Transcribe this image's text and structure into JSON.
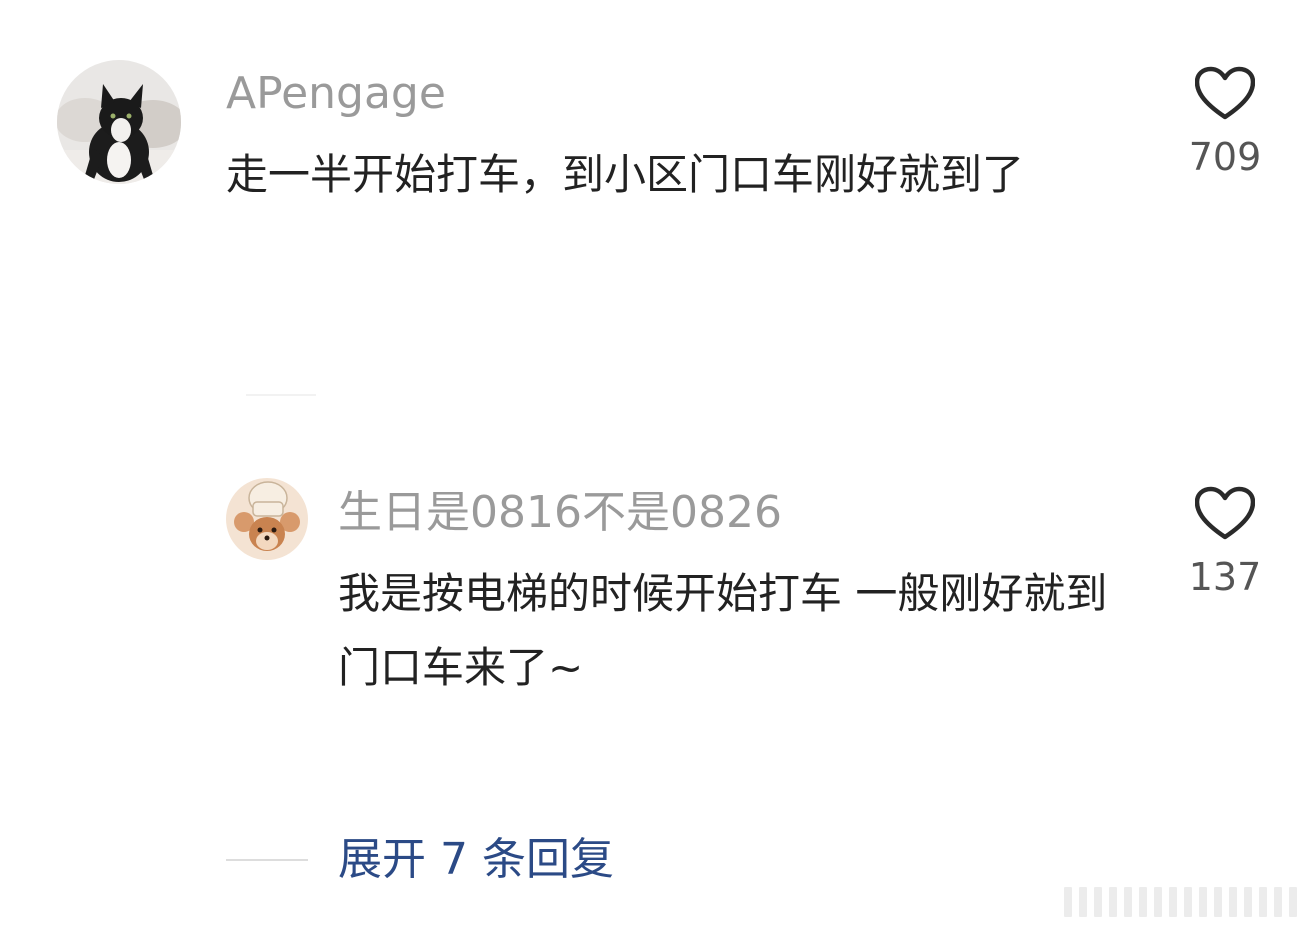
{
  "comments": [
    {
      "username": "APengage",
      "text": "走一半开始打车，到小区门口车刚好就到了",
      "likes": "709",
      "avatar": "cat-avatar"
    },
    {
      "username": "生日是0816不是0826",
      "text": "我是按电梯的时候开始打车 一般刚好就到门口车来了~",
      "likes": "137",
      "avatar": "cartoon-mouse-avatar"
    }
  ],
  "expand_replies": {
    "label": "展开 7 条回复"
  },
  "colors": {
    "username": "#9a9a9a",
    "comment_text": "#222222",
    "like_count": "#555555",
    "expand_link": "#2b4a86"
  },
  "icons": {
    "like": "heart-outline-icon"
  }
}
